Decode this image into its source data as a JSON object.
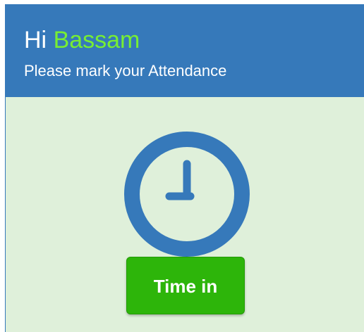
{
  "header": {
    "greeting_prefix": "Hi",
    "user_name": "Bassam",
    "subtitle": "Please mark your Attendance"
  },
  "main": {
    "clock_icon": "clock-icon",
    "time_in_label": "Time in"
  },
  "colors": {
    "header_bg": "#3679ba",
    "name_accent": "#77ee33",
    "panel_bg": "#dff0da",
    "button_bg": "#2db50a",
    "clock_color": "#3679ba"
  }
}
